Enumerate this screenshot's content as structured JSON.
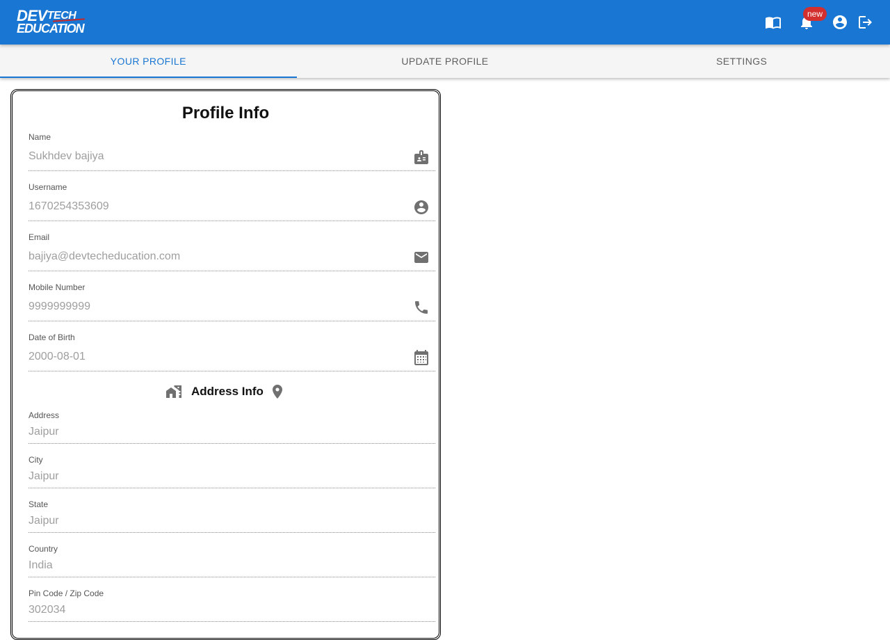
{
  "header": {
    "logo_line1_a": "DEV",
    "logo_line1_b": "TECH",
    "logo_line2": "EDUCATION",
    "notification_badge": "new",
    "icons": [
      "book-icon",
      "bell-icon",
      "account-circle-icon",
      "logout-icon"
    ],
    "color": "#1976d2"
  },
  "tabs": [
    {
      "label": "YOUR PROFILE",
      "active": true
    },
    {
      "label": "UPDATE PROFILE",
      "active": false
    },
    {
      "label": "SETTINGS",
      "active": false
    }
  ],
  "profile": {
    "title": "Profile Info",
    "fields": [
      {
        "label": "Name",
        "value": "Sukhdev bajiya",
        "icon": "badge-icon"
      },
      {
        "label": "Username",
        "value": "1670254353609",
        "icon": "account-circle-icon"
      },
      {
        "label": "Email",
        "value": "bajiya@devtecheducation.com",
        "icon": "email-icon"
      },
      {
        "label": "Mobile Number",
        "value": "9999999999",
        "icon": "phone-icon"
      },
      {
        "label": "Date of Birth",
        "value": "2000-08-01",
        "icon": "calendar-icon"
      }
    ]
  },
  "address": {
    "title": "Address Info",
    "icons": [
      "home-work-icon",
      "location-pin-icon"
    ],
    "fields": [
      {
        "label": "Address",
        "value": "Jaipur"
      },
      {
        "label": "City",
        "value": "Jaipur"
      },
      {
        "label": "State",
        "value": "Jaipur"
      },
      {
        "label": "Country",
        "value": "India"
      },
      {
        "label": "Pin Code / Zip Code",
        "value": "302034"
      }
    ]
  }
}
